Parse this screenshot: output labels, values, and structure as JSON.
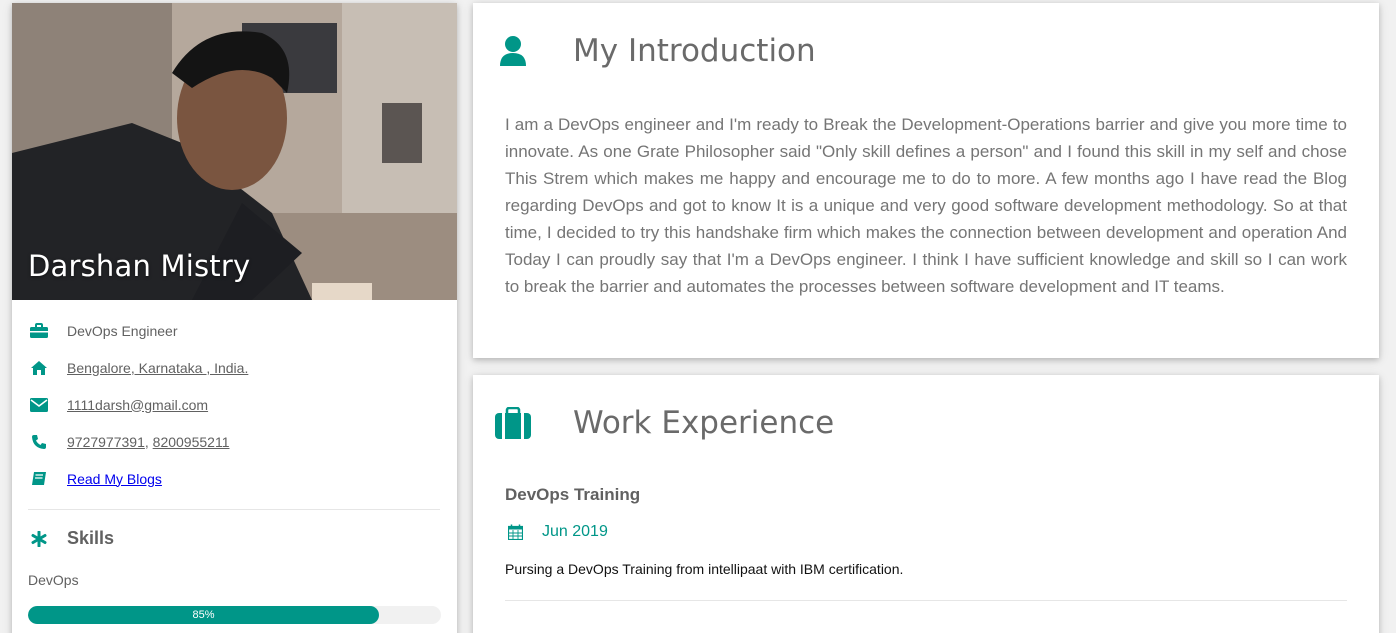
{
  "profile": {
    "name": "Darshan Mistry",
    "info": [
      {
        "icon": "briefcase-icon",
        "text": "DevOps Engineer"
      },
      {
        "icon": "home-icon",
        "text": "Bengalore, Karnataka , India."
      },
      {
        "icon": "envelope-icon",
        "text": "1111darsh@gmail.com"
      },
      {
        "icon": "phone-icon",
        "phone1": "9727977391",
        "sep": ", ",
        "phone2": "8200955211"
      },
      {
        "icon": "book-icon",
        "text": "Read My Blogs"
      }
    ],
    "skills_title": "Skills",
    "skills": [
      {
        "name": "DevOps",
        "percent_label": "85%",
        "percent": 85
      }
    ]
  },
  "intro": {
    "title": "My Introduction",
    "text": "I am a DevOps engineer and I'm ready to Break the Development-Operations barrier and give you more time to innovate. As one Grate Philosopher said \"Only skill defines a person\" and I found this skill in my self and chose This Strem which makes me happy and encourage me to do to more. A few months ago I have read the Blog regarding DevOps and got to know It is a unique and very good software development methodology. So at that time, I decided to try this handshake firm which makes the connection between development and operation And Today I can proudly say that I'm a DevOps engineer. I think I have sufficient knowledge and skill so I can work to break the barrier and automates the processes between software development and IT teams."
  },
  "work": {
    "title": "Work Experience",
    "jobs": [
      {
        "title": "DevOps Training",
        "date": "Jun 2019",
        "description": "Pursing a DevOps Training from intellipaat with IBM certification."
      }
    ]
  },
  "colors": {
    "accent": "#009688",
    "link_blue": "#0000ee"
  }
}
